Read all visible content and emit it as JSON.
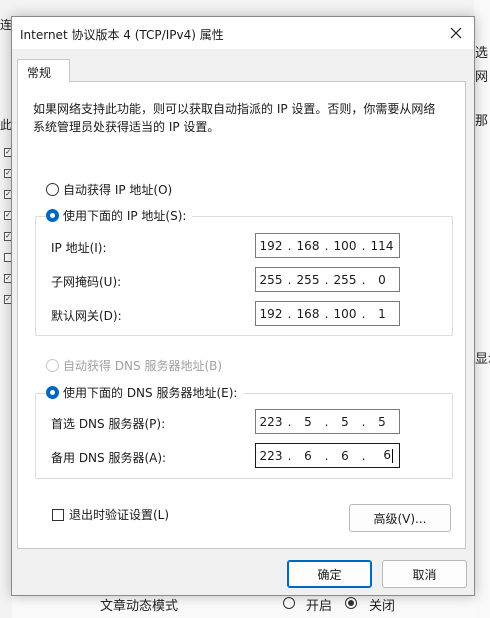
{
  "background": {
    "left_fragments": [
      "连",
      "此"
    ],
    "right_fragments": [
      "选",
      "网",
      "那",
      "显示"
    ],
    "bottom_label": "文章动态模式",
    "bottom_options": [
      "开启",
      "关闭"
    ]
  },
  "dialog": {
    "title": "Internet 协议版本 4 (TCP/IPv4) 属性",
    "tab_label": "常规",
    "intro_text": "如果网络支持此功能，则可以获取自动指派的 IP 设置。否则，你需要从网络系统管理员处获得适当的 IP 设置。",
    "ip_auto_label": "自动获得 IP 地址(O)",
    "ip_manual_label": "使用下面的 IP 地址(S):",
    "ip_fields": {
      "ip_label": "IP 地址(I):",
      "ip_value": [
        "192",
        "168",
        "100",
        "114"
      ],
      "mask_label": "子网掩码(U):",
      "mask_value": [
        "255",
        "255",
        "255",
        "0"
      ],
      "gateway_label": "默认网关(D):",
      "gateway_value": [
        "192",
        "168",
        "100",
        "1"
      ]
    },
    "dns_auto_label": "自动获得 DNS 服务器地址(B)",
    "dns_manual_label": "使用下面的 DNS 服务器地址(E):",
    "dns_fields": {
      "preferred_label": "首选 DNS 服务器(P):",
      "preferred_value": [
        "223",
        "5",
        "5",
        "5"
      ],
      "alternate_label": "备用 DNS 服务器(A):",
      "alternate_value": [
        "223",
        "6",
        "6",
        "6"
      ]
    },
    "validate_label": "退出时验证设置(L)",
    "advanced_button": "高级(V)...",
    "ok_button": "确定",
    "cancel_button": "取消"
  },
  "colors": {
    "accent": "#0067c0",
    "dialog_bg": "#f0f0f0",
    "panel_bg": "#ffffff"
  }
}
